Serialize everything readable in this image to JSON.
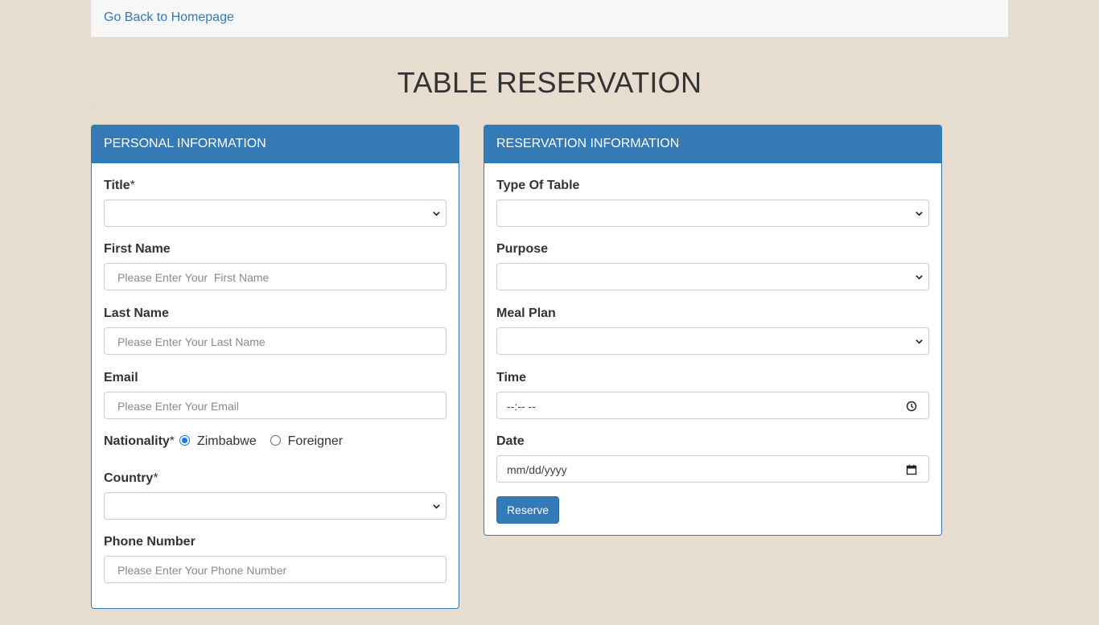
{
  "nav": {
    "back_link": "Go Back to Homepage"
  },
  "page": {
    "title": "TABLE RESERVATION"
  },
  "colors": {
    "primary": "#337ab7",
    "background": "#e6ddd0",
    "radio_checked": "#1a73e8"
  },
  "personal": {
    "heading": "PERSONAL INFORMATION",
    "title_label": "Title",
    "required_mark": "*",
    "title_value": "",
    "first_name_label": "First Name",
    "first_name_placeholder": "Please Enter Your  First Name",
    "last_name_label": "Last Name",
    "last_name_placeholder": "Please Enter Your Last Name",
    "email_label": "Email",
    "email_placeholder": "Please Enter Your Email",
    "nationality_label": "Nationality",
    "nationality_options": [
      "Zimbabwe",
      "Foreigner"
    ],
    "nationality_selected": "Zimbabwe",
    "country_label": "Country",
    "country_value": "",
    "phone_label": "Phone Number",
    "phone_placeholder": "Please Enter Your Phone Number"
  },
  "reservation": {
    "heading": "RESERVATION INFORMATION",
    "table_type_label": "Type Of Table",
    "table_type_value": "",
    "purpose_label": "Purpose",
    "purpose_value": "",
    "meal_plan_label": "Meal Plan",
    "meal_plan_value": "",
    "time_label": "Time",
    "time_placeholder": "--:-- --",
    "date_label": "Date",
    "date_placeholder": "mm/dd/yyyy",
    "reserve_button": "Reserve"
  },
  "icons": {
    "select": "chevron-down-icon",
    "time": "clock-icon",
    "date": "calendar-icon"
  }
}
